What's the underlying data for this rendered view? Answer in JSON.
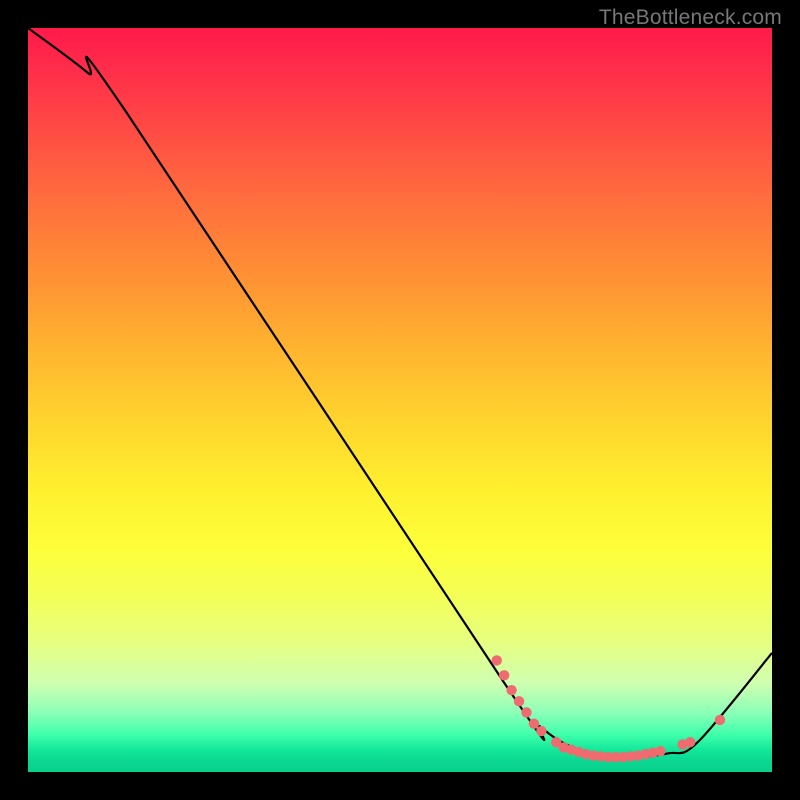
{
  "watermark": "TheBottleneck.com",
  "chart_data": {
    "type": "line",
    "title": "",
    "xlabel": "",
    "ylabel": "",
    "xlim": [
      0,
      100
    ],
    "ylim": [
      0,
      100
    ],
    "curve": {
      "name": "bottleneck-curve",
      "points": [
        {
          "x": 0,
          "y": 100
        },
        {
          "x": 8,
          "y": 94
        },
        {
          "x": 13,
          "y": 89
        },
        {
          "x": 64,
          "y": 12
        },
        {
          "x": 69,
          "y": 6
        },
        {
          "x": 74,
          "y": 3
        },
        {
          "x": 80,
          "y": 2
        },
        {
          "x": 86,
          "y": 2.5
        },
        {
          "x": 90,
          "y": 4
        },
        {
          "x": 100,
          "y": 16
        }
      ]
    },
    "markers": [
      {
        "x": 63,
        "y": 15
      },
      {
        "x": 64,
        "y": 13
      },
      {
        "x": 65,
        "y": 11
      },
      {
        "x": 66,
        "y": 9.5
      },
      {
        "x": 67,
        "y": 8
      },
      {
        "x": 68,
        "y": 6.5
      },
      {
        "x": 69,
        "y": 5.5
      },
      {
        "x": 71,
        "y": 4
      },
      {
        "x": 72,
        "y": 3.3
      },
      {
        "x": 73,
        "y": 3
      },
      {
        "x": 74,
        "y": 2.7
      },
      {
        "x": 75,
        "y": 2.4
      },
      {
        "x": 76,
        "y": 2.2
      },
      {
        "x": 77,
        "y": 2.1
      },
      {
        "x": 78,
        "y": 2.0
      },
      {
        "x": 79,
        "y": 2.0
      },
      {
        "x": 80,
        "y": 2.0
      },
      {
        "x": 81,
        "y": 2.1
      },
      {
        "x": 82,
        "y": 2.2
      },
      {
        "x": 83,
        "y": 2.4
      },
      {
        "x": 84,
        "y": 2.6
      },
      {
        "x": 85,
        "y": 2.8
      },
      {
        "x": 88,
        "y": 3.7
      },
      {
        "x": 89,
        "y": 4.0
      },
      {
        "x": 93,
        "y": 7.0
      }
    ],
    "colors": {
      "curve": "#000000",
      "markers": "#ef6b6f"
    }
  }
}
